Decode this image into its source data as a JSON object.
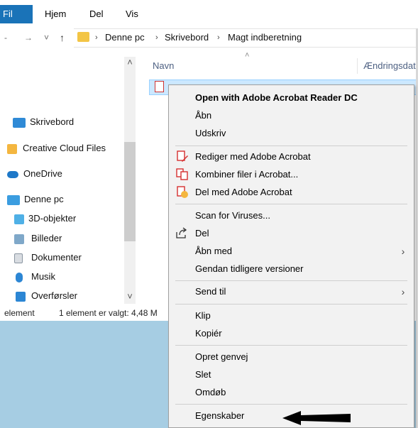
{
  "ribbon": {
    "tabs": [
      "Fil",
      "Hjem",
      "Del",
      "Vis"
    ]
  },
  "address": {
    "nav_glyphs": [
      "-",
      "→",
      "˅",
      "↑"
    ],
    "crumbs": [
      "Denne pc",
      "Skrivebord",
      "Magt indberetning"
    ],
    "separator": "›"
  },
  "nav_pane": {
    "items": [
      {
        "label": "Skrivebord",
        "icon": "desktop-icon"
      },
      {
        "label": "Creative Cloud Files",
        "icon": "creative-cloud-icon"
      },
      {
        "label": "OneDrive",
        "icon": "onedrive-icon"
      },
      {
        "label": "Denne pc",
        "icon": "computer-icon"
      },
      {
        "label": "3D-objekter",
        "icon": "3d-objects-icon"
      },
      {
        "label": "Billeder",
        "icon": "pictures-icon"
      },
      {
        "label": "Dokumenter",
        "icon": "documents-icon"
      },
      {
        "label": "Musik",
        "icon": "music-icon"
      },
      {
        "label": "Overførsler",
        "icon": "downloads-icon"
      }
    ],
    "scroll_up": "˄",
    "scroll_down": "˅"
  },
  "columns": {
    "name": "Navn",
    "modified": "Ændringsdat",
    "sort_glyph": "˄"
  },
  "status": {
    "count": "element",
    "selected": "1 element er valgt: 4,48 M"
  },
  "context_menu": {
    "items": [
      {
        "label": "Open with Adobe Acrobat Reader DC",
        "bold": true
      },
      {
        "label": "Åbn"
      },
      {
        "label": "Udskriv"
      },
      {
        "label": "Rediger med Adobe Acrobat",
        "icon": "acrobat-edit-icon"
      },
      {
        "label": "Kombiner filer i Acrobat...",
        "icon": "acrobat-combine-icon"
      },
      {
        "label": "Del med Adobe Acrobat",
        "icon": "acrobat-share-icon"
      },
      {
        "label": "Scan for Viruses..."
      },
      {
        "label": "Del",
        "icon": "share-icon"
      },
      {
        "label": "Åbn med",
        "submenu": true
      },
      {
        "label": "Gendan tidligere versioner"
      },
      {
        "label": "Send til",
        "submenu": true
      },
      {
        "label": "Klip"
      },
      {
        "label": "Kopiér"
      },
      {
        "label": "Opret genvej"
      },
      {
        "label": "Slet"
      },
      {
        "label": "Omdøb"
      },
      {
        "label": "Egenskaber"
      }
    ],
    "submenu_glyph": "›"
  },
  "colors": {
    "accent": "#1a73b8",
    "selection": "#cce8ff",
    "desktop": "#a6cde3",
    "acrobat_red": "#d62f2f"
  }
}
